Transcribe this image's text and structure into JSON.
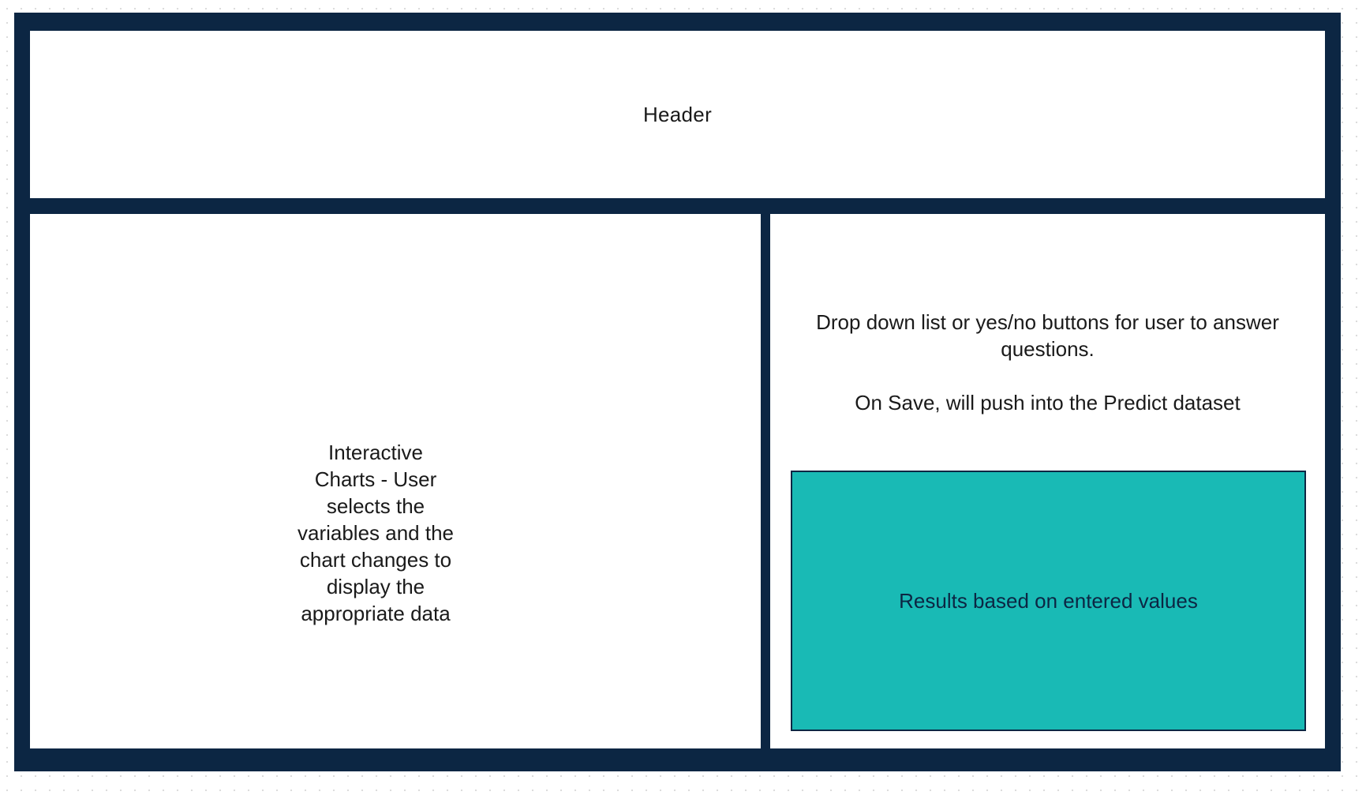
{
  "colors": {
    "frame": "#0c2643",
    "panel": "#ffffff",
    "results_fill": "#19bab5"
  },
  "header": {
    "label": "Header"
  },
  "left_panel": {
    "note": "Interactive Charts - User selects the variables and the chart changes to display the appropriate data"
  },
  "right_panel": {
    "questions_note": "Drop down list or yes/no buttons for user to answer questions.",
    "save_note": "On Save, will push into the Predict dataset",
    "results_label": "Results based on entered values"
  }
}
